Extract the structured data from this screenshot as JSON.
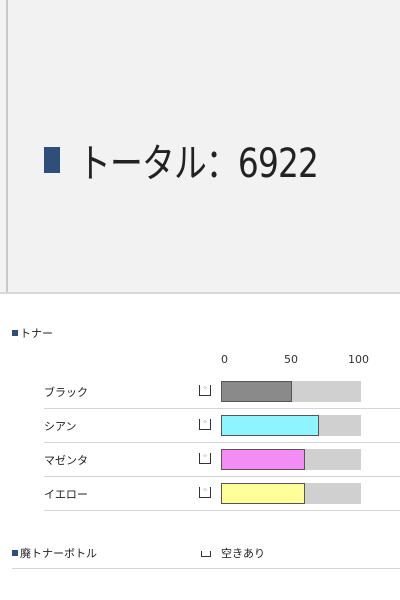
{
  "total": {
    "label": "トータル：6922"
  },
  "toner": {
    "heading": "トナー",
    "scale": [
      "0",
      "50",
      "100"
    ],
    "items": [
      {
        "label": "ブラック",
        "icon": "toner-icon",
        "level": 0.51,
        "color": "#8a8a8a"
      },
      {
        "label": "シアン",
        "icon": "toner-icon",
        "level": 0.7,
        "color": "#8ef4ff"
      },
      {
        "label": "マゼンタ",
        "icon": "toner-icon",
        "level": 0.6,
        "color": "#f58cf5"
      },
      {
        "label": "イエロー",
        "icon": "toner-icon",
        "level": 0.6,
        "color": "#ffff99"
      }
    ]
  },
  "waste": {
    "heading": "廃トナーボトル",
    "icon": "waste-bottle-icon",
    "status": "空きあり"
  },
  "colors": {
    "section_square": "#2f4e7a",
    "track": "#d0d0d0"
  }
}
